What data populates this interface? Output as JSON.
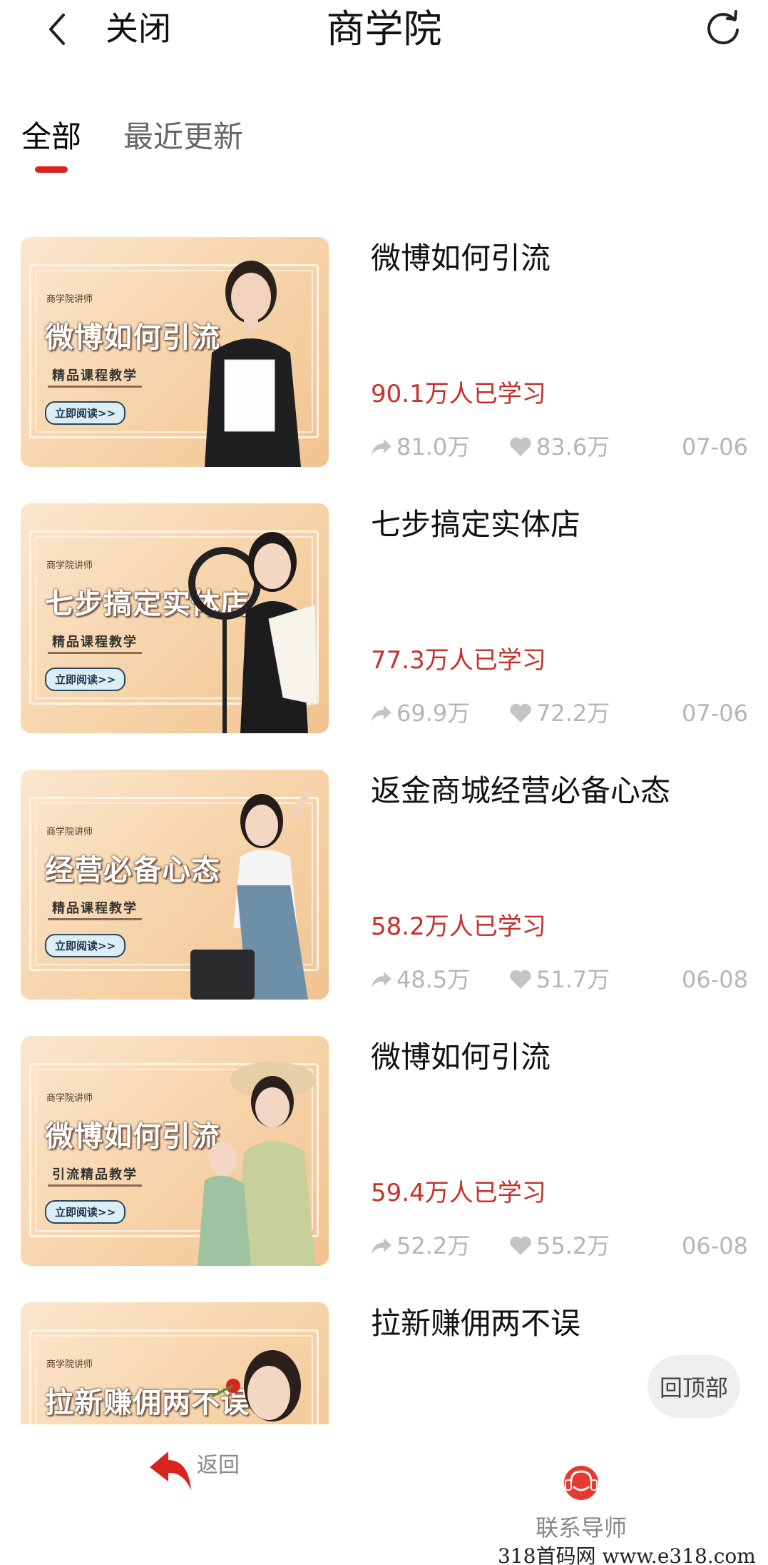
{
  "header": {
    "title": "商学院",
    "close_label": "关闭"
  },
  "tabs": [
    {
      "label": "全部",
      "active": true
    },
    {
      "label": "最近更新",
      "active": false
    }
  ],
  "colors": {
    "accent": "#d8241f",
    "learn_count": "#c8302a",
    "muted": "#b5b5b5"
  },
  "thumb_common": {
    "lecturer": "商学院讲师",
    "read_button": "立即阅读>>"
  },
  "courses": [
    {
      "title": "微博如何引流",
      "thumb_title": "微博如何引流",
      "thumb_sub": "精品课程教学",
      "learned": "90.1万人已学习",
      "shares": "81.0万",
      "likes": "83.6万",
      "date": "07-06"
    },
    {
      "title": "七步搞定实体店",
      "thumb_title": "七步搞定实体店",
      "thumb_sub": "精品课程教学",
      "learned": "77.3万人已学习",
      "shares": "69.9万",
      "likes": "72.2万",
      "date": "07-06"
    },
    {
      "title": "返金商城经营必备心态",
      "thumb_title": "经营必备心态",
      "thumb_sub": "精品课程教学",
      "learned": "58.2万人已学习",
      "shares": "48.5万",
      "likes": "51.7万",
      "date": "06-08"
    },
    {
      "title": "微博如何引流",
      "thumb_title": "微博如何引流",
      "thumb_sub": "引流精品教学",
      "learned": "59.4万人已学习",
      "shares": "52.2万",
      "likes": "55.2万",
      "date": "06-08"
    },
    {
      "title": "拉新赚佣两不误",
      "thumb_title": "拉新赚佣两不误",
      "thumb_sub": "",
      "learned": "",
      "shares": "",
      "likes": "",
      "date": ""
    }
  ],
  "back_to_top_label": "回顶部",
  "bottom_bar": {
    "return_label": "返回",
    "contact_label": "联系导师"
  },
  "watermark": "318首码网  www.e318.com"
}
